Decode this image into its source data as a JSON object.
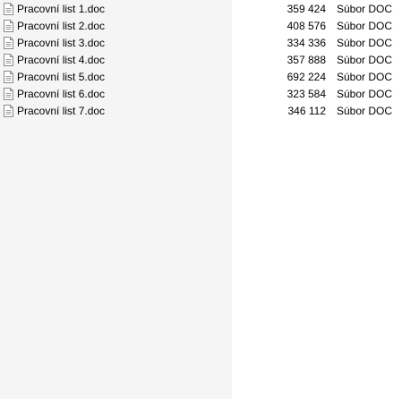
{
  "files": [
    {
      "name": "Pracovní list 1.doc",
      "size": "359 424",
      "type": "Súbor DOC",
      "icon": "document-icon"
    },
    {
      "name": "Pracovní list 2.doc",
      "size": "408 576",
      "type": "Súbor DOC",
      "icon": "document-icon"
    },
    {
      "name": "Pracovní list 3.doc",
      "size": "334 336",
      "type": "Súbor DOC",
      "icon": "document-icon"
    },
    {
      "name": "Pracovní list 4.doc",
      "size": "357 888",
      "type": "Súbor DOC",
      "icon": "document-icon"
    },
    {
      "name": "Pracovní list 5.doc",
      "size": "692 224",
      "type": "Súbor DOC",
      "icon": "document-icon"
    },
    {
      "name": "Pracovní list 6.doc",
      "size": "323 584",
      "type": "Súbor DOC",
      "icon": "document-icon"
    },
    {
      "name": "Pracovní list 7.doc",
      "size": "346 112",
      "type": "Súbor DOC",
      "icon": "document-icon"
    }
  ],
  "colors": {
    "name_column_bg": "#f5f5f5",
    "background": "#ffffff",
    "text": "#000000",
    "icon_stroke": "#8a8a8a"
  }
}
